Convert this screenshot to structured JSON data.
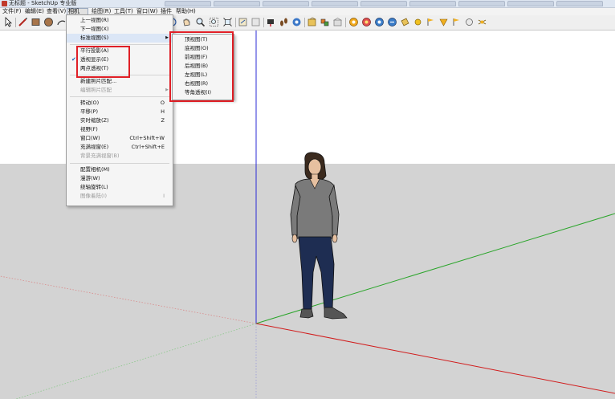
{
  "window": {
    "title": "无标题 - SketchUp 专业版"
  },
  "menubar": [
    {
      "label": "文件(F)"
    },
    {
      "label": "编辑(E)"
    },
    {
      "label": "查看(V)"
    },
    {
      "label": "相机(C)"
    },
    {
      "label": "绘图(R)"
    },
    {
      "label": "工具(T)"
    },
    {
      "label": "窗口(W)"
    },
    {
      "label": "插件"
    },
    {
      "label": "帮助(H)"
    }
  ],
  "camera_menu": {
    "items": [
      {
        "label": "上一视图(R)",
        "shortcut": ""
      },
      {
        "label": "下一视图(X)",
        "shortcut": ""
      },
      {
        "label": "标准视图(S)",
        "shortcut": ""
      },
      {
        "label": "平行投影(A)",
        "shortcut": ""
      },
      {
        "label": "透视显示(E)",
        "shortcut": ""
      },
      {
        "label": "两点透视(T)",
        "shortcut": ""
      },
      {
        "label": "新建照片匹配...",
        "shortcut": ""
      },
      {
        "label": "编辑照片匹配",
        "shortcut": ""
      },
      {
        "label": "转动(O)",
        "shortcut": "O"
      },
      {
        "label": "平移(P)",
        "shortcut": "H"
      },
      {
        "label": "实时缩放(Z)",
        "shortcut": "Z"
      },
      {
        "label": "视野(F)",
        "shortcut": ""
      },
      {
        "label": "窗口(W)",
        "shortcut": "Ctrl+Shift+W"
      },
      {
        "label": "充满视窗(E)",
        "shortcut": "Ctrl+Shift+E"
      },
      {
        "label": "背景充满视窗(B)",
        "shortcut": ""
      },
      {
        "label": "配置相机(M)",
        "shortcut": ""
      },
      {
        "label": "漫游(W)",
        "shortcut": ""
      },
      {
        "label": "绕轴旋转(L)",
        "shortcut": ""
      },
      {
        "label": "图像着陆(I)",
        "shortcut": "I"
      }
    ]
  },
  "standard_views_submenu": {
    "items": [
      {
        "label": "顶视图(T)"
      },
      {
        "label": "底视图(O)"
      },
      {
        "label": "前视图(F)"
      },
      {
        "label": "后视图(B)"
      },
      {
        "label": "左视图(L)"
      },
      {
        "label": "右视图(R)"
      },
      {
        "label": "等角透视(I)"
      }
    ]
  },
  "colors": {
    "red_axis": "#d11c1c",
    "green_axis": "#2aa52a",
    "blue_axis": "#2b2bd6",
    "highlight_box": "#e01f26",
    "menu_highlight": "#dbe6f6"
  }
}
